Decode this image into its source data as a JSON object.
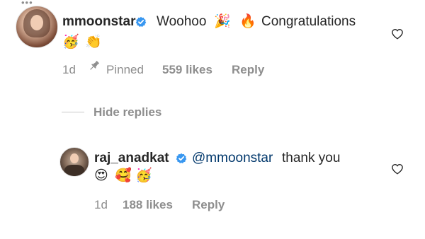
{
  "comments": [
    {
      "username": "mmoonstar",
      "text": "Woohoo",
      "text_after": "Congratulations",
      "emoji_inline": [
        "🎉",
        "🔥"
      ],
      "emoji_second_line": [
        "🥳",
        "👏"
      ],
      "time": "1d",
      "pinned_label": "Pinned",
      "likes": "559 likes",
      "reply_label": "Reply"
    }
  ],
  "hide_replies_label": "Hide replies",
  "replies": [
    {
      "username": "raj_anadkat",
      "mention": "@mmoonstar",
      "text": "thank you",
      "emoji": [
        "😍",
        "🥰",
        "🥳"
      ],
      "time": "1d",
      "likes": "188 likes",
      "reply_label": "Reply"
    }
  ],
  "colors": {
    "verified": "#3897f0",
    "mention": "#00376b",
    "meta": "#8e8e8e"
  },
  "icons": {
    "more": "more-dots-icon",
    "verified": "verified-badge-icon",
    "pin": "pin-icon",
    "like": "heart-outline-icon"
  }
}
